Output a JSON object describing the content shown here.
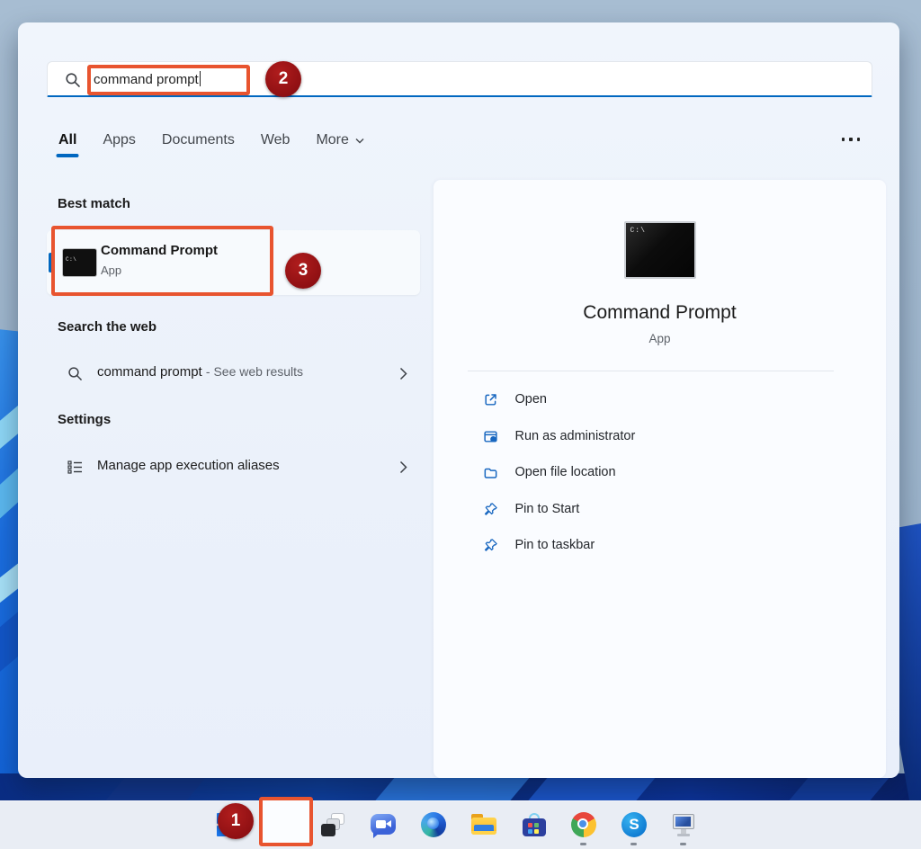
{
  "search_bar": {
    "value": "command prompt"
  },
  "tabs": {
    "items": [
      {
        "label": "All"
      },
      {
        "label": "Apps"
      },
      {
        "label": "Documents"
      },
      {
        "label": "Web"
      },
      {
        "label": "More"
      }
    ]
  },
  "sections": {
    "best_match": {
      "heading": "Best match",
      "result_title": "Command Prompt",
      "result_subtitle": "App",
      "icon_label": "C:\\"
    },
    "web": {
      "heading": "Search the web",
      "query": "command prompt",
      "suffix": "- See web results"
    },
    "settings": {
      "heading": "Settings",
      "item_label": "Manage app execution aliases"
    }
  },
  "preview": {
    "title": "Command Prompt",
    "subtitle": "App",
    "icon_label": "C:\\",
    "actions": [
      {
        "label": "Open"
      },
      {
        "label": "Run as administrator"
      },
      {
        "label": "Open file location"
      },
      {
        "label": "Pin to Start"
      },
      {
        "label": "Pin to taskbar"
      }
    ]
  },
  "annotations": {
    "steps": [
      {
        "n": "1"
      },
      {
        "n": "2"
      },
      {
        "n": "3"
      }
    ],
    "highlight_color": "#e8542f",
    "badge_color": "#8d0f12"
  },
  "colors": {
    "accent": "#0067c0"
  }
}
